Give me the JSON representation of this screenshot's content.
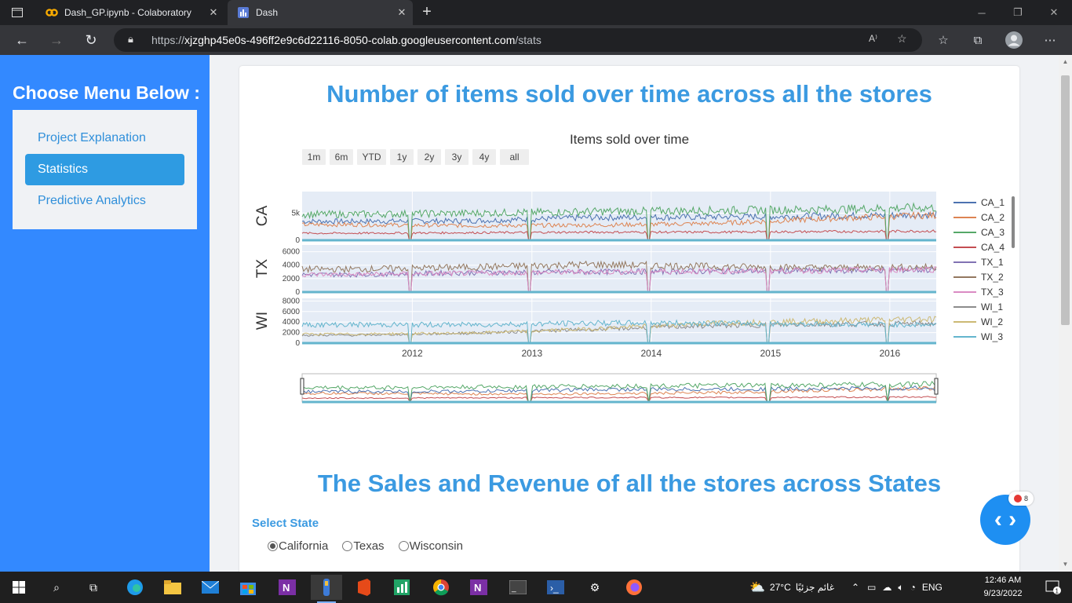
{
  "browser": {
    "tabs": [
      {
        "title": "Dash_GP.ipynb - Colaboratory",
        "active": false
      },
      {
        "title": "Dash",
        "active": true
      }
    ],
    "url_prefix": "https://",
    "url_host": "xjzghp45e0s-496ff2e9c6d22116-8050-colab.googleusercontent.com",
    "url_path": "/stats"
  },
  "sidebar": {
    "heading": "Choose Menu Below :",
    "items": [
      {
        "label": "Project Explanation",
        "active": false
      },
      {
        "label": "Statistics",
        "active": true
      },
      {
        "label": "Predictive Analytics",
        "active": false
      }
    ]
  },
  "main": {
    "title1": "Number of items sold over time across all the stores",
    "title2": "The Sales and Revenue of all the stores across States",
    "select_label": "Select State",
    "radios": [
      {
        "label": "California",
        "checked": true
      },
      {
        "label": "Texas",
        "checked": false
      },
      {
        "label": "Wisconsin",
        "checked": false
      }
    ]
  },
  "chart_data": {
    "type": "line",
    "title": "Items sold over time",
    "range_buttons": [
      "1m",
      "6m",
      "YTD",
      "1y",
      "2y",
      "3y",
      "4y",
      "all"
    ],
    "x_ticks": [
      "2012",
      "2013",
      "2014",
      "2015",
      "2016"
    ],
    "x_range": [
      "2011-01-29",
      "2016-05-22"
    ],
    "facets": [
      {
        "label": "CA",
        "y_ticks": [
          "0",
          "5k"
        ],
        "y_range": [
          0,
          9000
        ],
        "series": [
          "CA_1",
          "CA_2",
          "CA_3",
          "CA_4"
        ]
      },
      {
        "label": "TX",
        "y_ticks": [
          "0",
          "2000",
          "4000",
          "6000"
        ],
        "y_range": [
          0,
          7000
        ],
        "series": [
          "TX_1",
          "TX_2",
          "TX_3"
        ]
      },
      {
        "label": "WI",
        "y_ticks": [
          "0",
          "2000",
          "4000",
          "6000",
          "8000"
        ],
        "y_range": [
          0,
          8500
        ],
        "series": [
          "WI_1",
          "WI_2",
          "WI_3"
        ]
      }
    ],
    "legend": [
      {
        "name": "CA_1",
        "color": "#4c72b0"
      },
      {
        "name": "CA_2",
        "color": "#dd8452"
      },
      {
        "name": "CA_3",
        "color": "#55a868"
      },
      {
        "name": "CA_4",
        "color": "#c44e52"
      },
      {
        "name": "TX_1",
        "color": "#8172b3"
      },
      {
        "name": "TX_2",
        "color": "#937860"
      },
      {
        "name": "TX_3",
        "color": "#da8bc3"
      },
      {
        "name": "WI_1",
        "color": "#8c8c8c"
      },
      {
        "name": "WI_2",
        "color": "#ccb974"
      },
      {
        "name": "WI_3",
        "color": "#64b5cd"
      }
    ],
    "approx_levels": {
      "CA_1": [
        3500,
        3600,
        4200,
        4300,
        4500,
        4700
      ],
      "CA_2": [
        2900,
        2700,
        2800,
        3100,
        4000,
        4600
      ],
      "CA_3": [
        4800,
        5000,
        5300,
        5500,
        5700,
        6000
      ],
      "CA_4": [
        1300,
        1400,
        1500,
        1500,
        1600,
        1700
      ],
      "TX_1": [
        2600,
        2900,
        3000,
        3100,
        3200,
        3300
      ],
      "TX_2": [
        3400,
        3700,
        4100,
        3800,
        3600,
        3700
      ],
      "TX_3": [
        2600,
        2800,
        3000,
        3100,
        3200,
        3400
      ],
      "WI_1": [
        1500,
        1900,
        2600,
        3300,
        3600,
        3700
      ],
      "WI_2": [
        1700,
        1900,
        2700,
        3800,
        4200,
        4600
      ],
      "WI_3": [
        3500,
        3500,
        3800,
        3800,
        3600,
        3500
      ]
    },
    "grid": true,
    "legend_position": "right"
  },
  "fab": {
    "badge_count": "8"
  },
  "taskbar": {
    "weather_temp": "27°C",
    "weather_text": "غائم جزئيًا",
    "lang": "ENG",
    "time": "12:46 AM",
    "date": "9/23/2022",
    "notif_count": "1"
  }
}
